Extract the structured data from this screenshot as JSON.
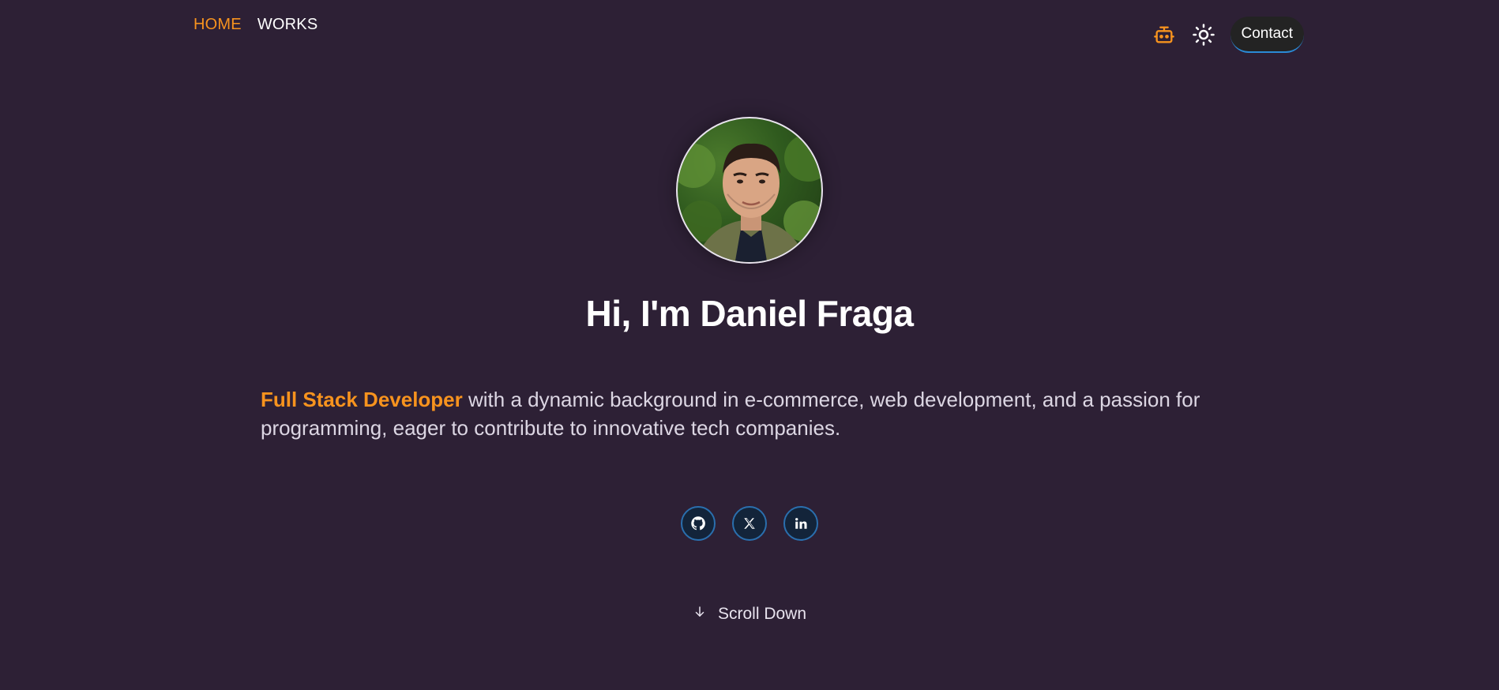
{
  "nav": {
    "links": [
      {
        "label": "HOME",
        "active": true
      },
      {
        "label": "WORKS",
        "active": false
      }
    ],
    "assistant_icon": "robot-icon",
    "theme_icon": "sun-icon",
    "contact_label": "Contact"
  },
  "hero": {
    "headline": "Hi, I'm Daniel Fraga",
    "intro_accent": "Full Stack Developer",
    "intro_text": " with a dynamic background in e-commerce, web development, and a passion for programming, eager to contribute to innovative tech companies."
  },
  "social": {
    "icons": [
      "github-icon",
      "x-icon",
      "linkedin-icon"
    ]
  },
  "scroll": {
    "label": "Scroll Down",
    "icon": "arrow-down-icon"
  },
  "colors": {
    "background": "#2d2035",
    "accent": "#f7931e",
    "social_ring": "#2a6fae",
    "contact_bg": "#232323"
  }
}
